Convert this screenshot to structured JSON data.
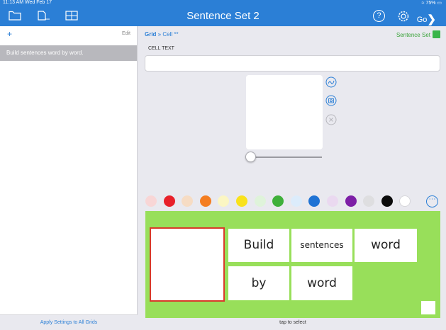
{
  "status_bar": {
    "time": "11:13 AM  Wed Feb 17",
    "battery": "75%"
  },
  "header": {
    "title": "Sentence Set 2",
    "help_label": "?",
    "go_label": "Go"
  },
  "sidebar": {
    "add_label": "+",
    "edit_label": "Edit",
    "items": [
      {
        "label": "Build sentences word by word."
      }
    ],
    "apply_label": "Apply Settings to All Grids"
  },
  "breadcrumb": {
    "root": "Grid",
    "separator": " » ",
    "current": "Cell **"
  },
  "sentence_set_link": "Sentence Set",
  "editor": {
    "cell_text_label": "CELL TEXT",
    "cell_text_value": ""
  },
  "swatches": [
    "#f8d6d6",
    "#e8212a",
    "#f6dcc4",
    "#f47d20",
    "#fbf6c3",
    "#f9e21c",
    "#dff3da",
    "#3fb03a",
    "#dcecfb",
    "#1f73d4",
    "#ead9f0",
    "#7d1fa6",
    "#dedee0",
    "#0b0b0b",
    "#ffffff"
  ],
  "grid_cells": [
    {
      "text": "Build"
    },
    {
      "text": "sentences"
    },
    {
      "text": "word"
    },
    {
      "text": "by"
    },
    {
      "text": "word"
    }
  ],
  "tap_hint": "tap to select",
  "colors": {
    "nav_blue": "#2b7fd6",
    "grid_green": "#98df5a",
    "selected_red": "#d93a2a"
  }
}
